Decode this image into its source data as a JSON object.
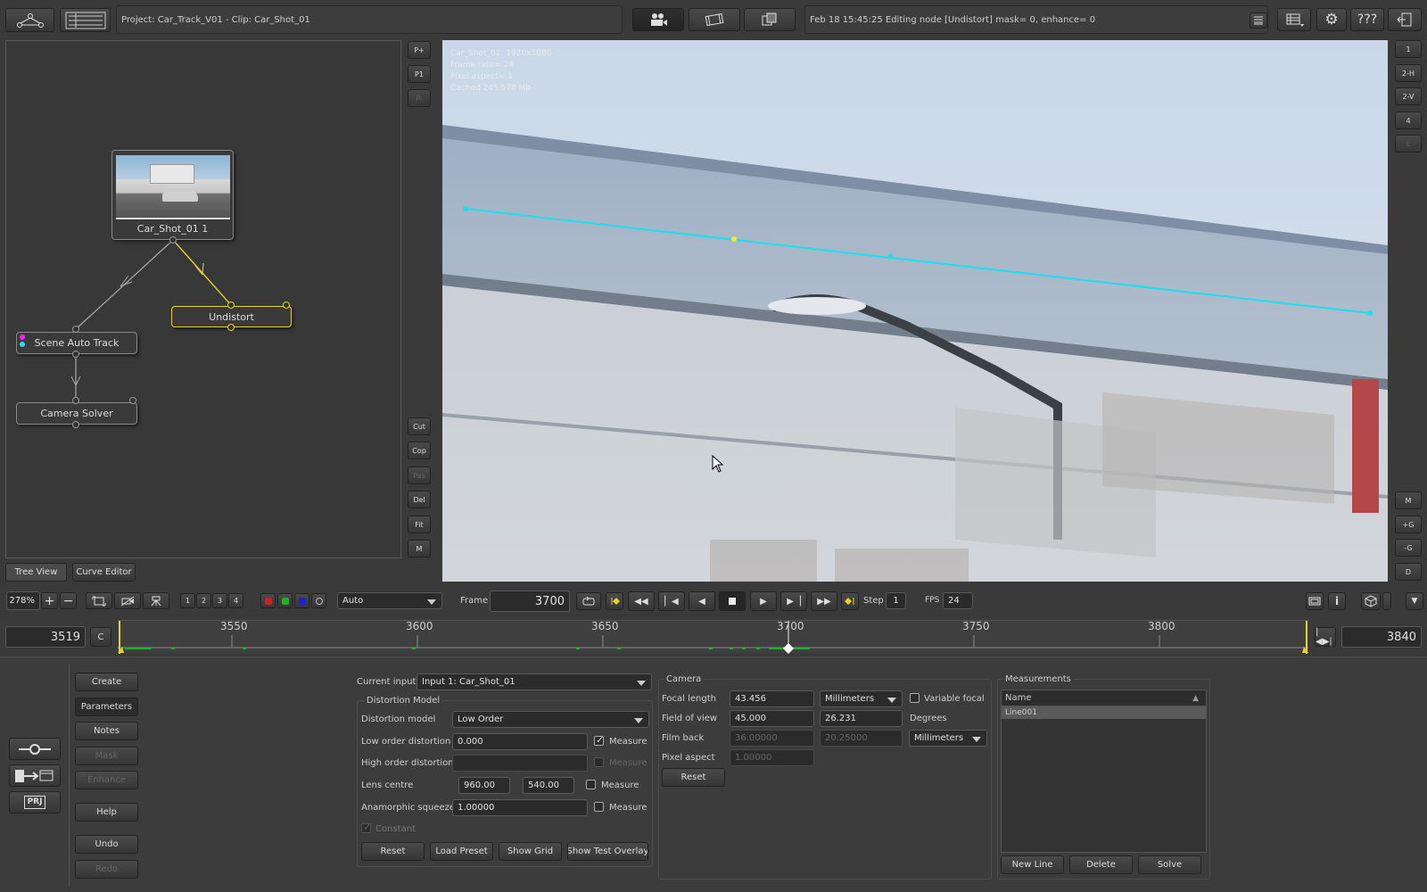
{
  "topbar": {
    "project_label": "Project: Car_Track_V01 - Clip: Car_Shot_01",
    "status": "Feb 18 15:45:25 Editing node [Undistort] mask= 0, enhance= 0",
    "help_label": "???"
  },
  "tree_side_buttons": [
    "P+",
    "P1",
    "P-",
    "Cut",
    "Cop",
    "Pas",
    "Del",
    "Fit",
    "M"
  ],
  "nodes": {
    "clip": "Car_Shot_01 1",
    "undistort": "Undistort",
    "scene_auto_track": "Scene Auto Track",
    "camera_solver": "Camera Solver"
  },
  "tree_tabs": {
    "tree_view": "Tree View",
    "curve_editor": "Curve Editor"
  },
  "viewer_info": {
    "line1": "Car_Shot_01: 1920x1080",
    "line2": "Frame rate= 24",
    "line3": "Pixel aspect= 1",
    "line4": "Cached 245.578 Mb"
  },
  "viewer_side_buttons": [
    "1",
    "2-H",
    "2-V",
    "4",
    "L",
    "M",
    "+G",
    "-G",
    "D"
  ],
  "toolbar": {
    "zoom": "278%",
    "view_numbers": [
      "1",
      "2",
      "3",
      "4"
    ],
    "channel_mode": "Auto",
    "frame_label": "Frame",
    "frame_value": "3700",
    "step_label": "Step",
    "step_value": "1",
    "fps_label": "FPS",
    "fps_value": "24"
  },
  "timeline": {
    "start": "3519",
    "c_label": "C",
    "end": "3840",
    "ticks": [
      "3550",
      "3600",
      "3650",
      "3700",
      "3750",
      "3800"
    ],
    "current": 3700
  },
  "left_menu": {
    "create": "Create",
    "parameters": "Parameters",
    "notes": "Notes",
    "mask": "Mask",
    "enhance": "Enhance",
    "help": "Help",
    "undo": "Undo",
    "redo": "Redo",
    "prj": "PRJ"
  },
  "params": {
    "current_input_label": "Current input",
    "current_input_value": "Input 1: Car_Shot_01",
    "distortion_group": "Distortion Model",
    "distortion_model_label": "Distortion model",
    "distortion_model_value": "Low Order",
    "low_order_label": "Low order distortion",
    "low_order_value": "0.000",
    "high_order_label": "High order distortion",
    "high_order_value": "",
    "measure": "Measure",
    "lens_centre_label": "Lens centre",
    "lens_centre_x": "960.00",
    "lens_centre_y": "540.00",
    "anamorphic_label": "Anamorphic squeeze",
    "anamorphic_value": "1.00000",
    "constant_label": "Constant",
    "reset": "Reset",
    "load_preset": "Load Preset",
    "show_grid": "Show Grid",
    "show_test_overlay": "Show Test Overlay"
  },
  "camera": {
    "group": "Camera",
    "focal_length_label": "Focal length",
    "focal_length_value": "43.456",
    "focal_units": "Millimeters",
    "variable_focal": "Variable focal",
    "fov_label": "Field of view",
    "fov_h": "45.000",
    "fov_v": "26.231",
    "degrees": "Degrees",
    "film_back_label": "Film back",
    "film_back_w": "36.00000",
    "film_back_h": "20.25000",
    "film_units": "Millimeters",
    "pixel_aspect_label": "Pixel aspect",
    "pixel_aspect_value": "1.00000",
    "reset": "Reset"
  },
  "measurements": {
    "group": "Measurements",
    "name_header": "Name",
    "items": [
      "Line001"
    ],
    "new_line": "New Line",
    "delete": "Delete",
    "solve": "Solve"
  },
  "colors": {
    "accent_yellow": "#e6d22a",
    "line_cyan": "#19e0f0",
    "panel": "#3a3a3a",
    "field": "#2b2b2b"
  }
}
